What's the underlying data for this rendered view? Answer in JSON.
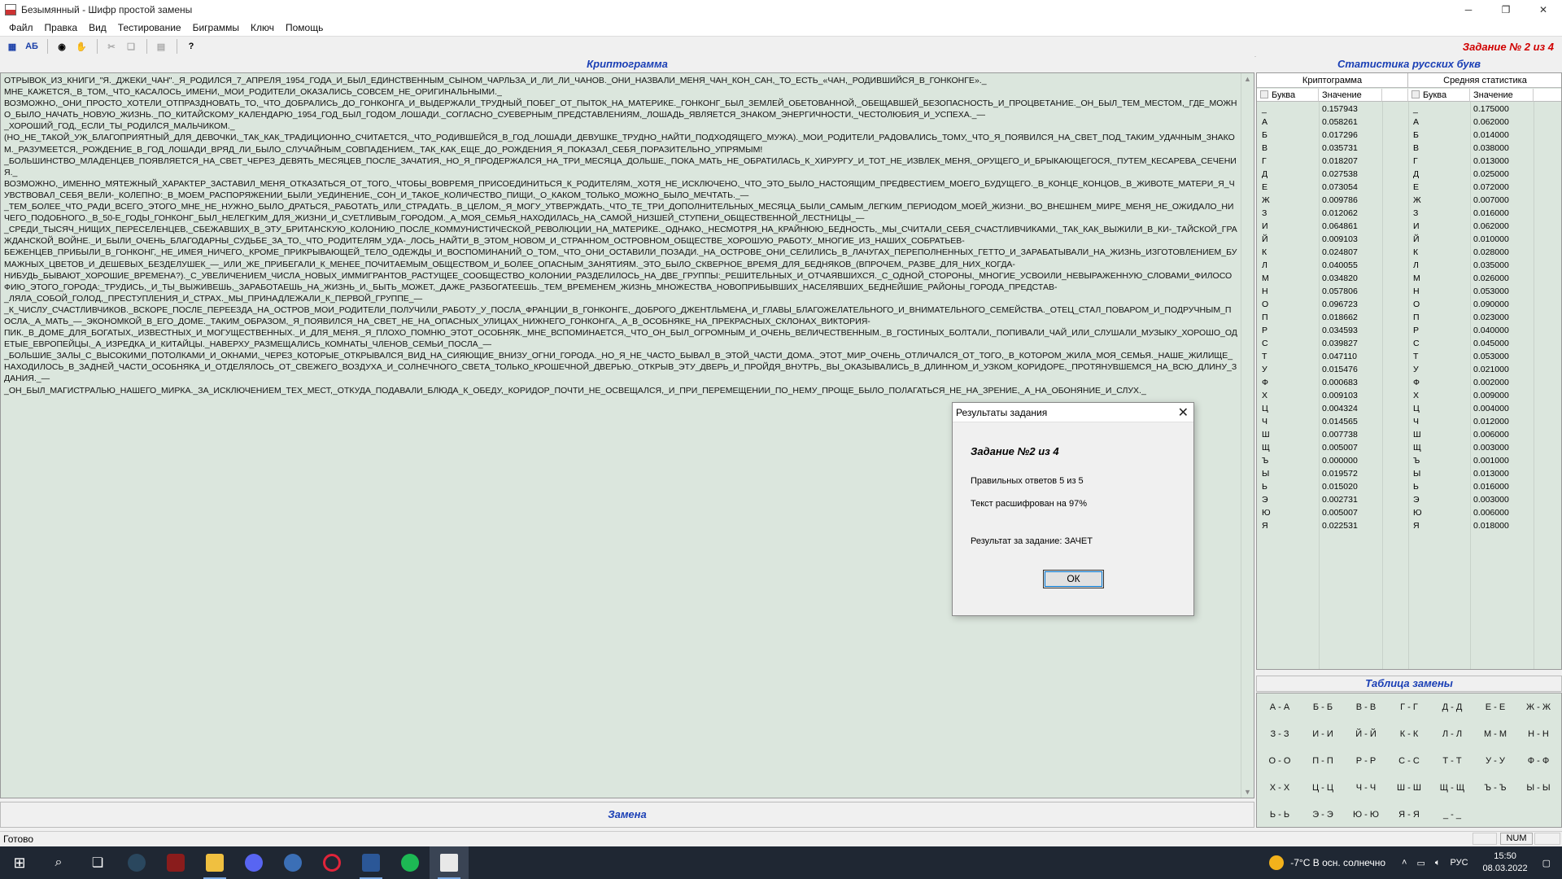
{
  "window": {
    "title": "Безымянный - Шифр простой замены"
  },
  "menu": [
    "Файл",
    "Правка",
    "Вид",
    "Тестирование",
    "Биграммы",
    "Ключ",
    "Помощь"
  ],
  "toolbar": {
    "btn_grid": "▦",
    "btn_ab": "АБ",
    "task_label": "Задание № 2 из 4"
  },
  "crypto": {
    "header": "Криптограмма",
    "text": "ОТРЫВОК_ИЗ_КНИГИ_\"Я._ДЖЕКИ_ЧАН\"._Я_РОДИЛСЯ_7_АПРЕЛЯ_1954_ГОДА_И_БЫЛ_ЕДИНСТВЕННЫМ_СЫНОМ_ЧАРЛЬЗА_И_ЛИ_ЛИ_ЧАНОВ._ОНИ_НАЗВАЛИ_МЕНЯ_ЧАН_КОН_САН,_ТО_ЕСТЬ_«ЧАН,_РОДИВШИЙСЯ_В_ГОНКОНГЕ»._\nМНЕ_КАЖЕТСЯ,_В_ТОМ,_ЧТО_КАСАЛОСЬ_ИМЕНИ,_МОИ_РОДИТЕЛИ_ОКАЗАЛИСЬ_СОВСЕМ_НЕ_ОРИГИНАЛЬНЫМИ._\nВОЗМОЖНО,_ОНИ_ПРОСТО_ХОТЕЛИ_ОТПРАЗДНОВАТЬ_ТО,_ЧТО_ДОБРАЛИСЬ_ДО_ГОНКОНГА_И_ВЫДЕРЖАЛИ_ТРУДНЫЙ_ПОБЕГ_ОТ_ПЫТОК_НА_МАТЕРИКЕ._ГОНКОНГ_БЫЛ_ЗЕМЛЕЙ_ОБЕТОВАННОЙ,_ОБЕЩАВШЕЙ_БЕЗОПАСНОСТЬ_И_ПРОЦВЕТАНИЕ._ОН_БЫЛ_ТЕМ_МЕСТОМ,_ГДЕ_МОЖНО_БЫЛО_НАЧАТЬ_НОВУЮ_ЖИЗНЬ._ПО_КИТАЙСКОМУ_КАЛЕНДАРЮ_1954_ГОД_БЫЛ_ГОДОМ_ЛОШАДИ._СОГЛАСНО_СУЕВЕРНЫМ_ПРЕДСТАВЛЕНИЯМ,_ЛОШАДЬ_ЯВЛЯЕТСЯ_ЗНАКОМ_ЭНЕРГИЧНОСТИ,_ЧЕСТОЛЮБИЯ_И_УСПЕХА._—\n_ХОРОШИЙ_ГОД,_ЕСЛИ_ТЫ_РОДИЛСЯ_МАЛЬЧИКОМ._\n(НО_НЕ_ТАКОЙ_УЖ_БЛАГОПРИЯТНЫЙ_ДЛЯ_ДЕВОЧКИ,_ТАК_КАК_ТРАДИЦИОННО_СЧИТАЕТСЯ,_ЧТО_РОДИВШЕЙСЯ_В_ГОД_ЛОШАДИ_ДЕВУШКЕ_ТРУДНО_НАЙТИ_ПОДХОДЯЩЕГО_МУЖА)._МОИ_РОДИТЕЛИ_РАДОВАЛИСЬ_ТОМУ,_ЧТО_Я_ПОЯВИЛСЯ_НА_СВЕТ_ПОД_ТАКИМ_УДАЧНЫМ_ЗНАКОМ._РАЗУМЕЕТСЯ,_РОЖДЕНИЕ_В_ГОД_ЛОШАДИ_ВРЯД_ЛИ_БЫЛО_СЛУЧАЙНЫМ_СОВПАДЕНИЕМ,_ТАК_КАК_ЕЩЕ_ДО_РОЖДЕНИЯ_Я_ПОКАЗАЛ_СЕБЯ_ПОРАЗИТЕЛЬНО_УПРЯМЫМ!\n_БОЛЬШИНСТВО_МЛАДЕНЦЕВ_ПОЯВЛЯЕТСЯ_НА_СВЕТ_ЧЕРЕЗ_ДЕВЯТЬ_МЕСЯЦЕВ_ПОСЛЕ_ЗАЧАТИЯ,_НО_Я_ПРОДЕРЖАЛСЯ_НА_ТРИ_МЕСЯЦА_ДОЛЬШЕ,_ПОКА_МАТЬ_НЕ_ОБРАТИЛАСЬ_К_ХИРУРГУ_И_ТОТ_НЕ_ИЗВЛЕК_МЕНЯ,_ОРУЩЕГО_И_БРЫКАЮЩЕГОСЯ,_ПУТЕМ_КЕСАРЕВА_СЕЧЕНИЯ._\nВОЗМОЖНО,_ИМЕННО_МЯТЕЖНЫЙ_ХАРАКТЕР_ЗАСТАВИЛ_МЕНЯ_ОТКАЗАТЬСЯ_ОТ_ТОГО,_ЧТОБЫ_ВОВРЕМЯ_ПРИСОЕДИНИТЬСЯ_К_РОДИТЕЛЯМ,_ХОТЯ_НЕ_ИСКЛЮЧЕНО,_ЧТО_ЭТО_БЫЛО_НАСТОЯЩИМ_ПРЕДВЕСТИЕМ_МОЕГО_БУДУЩЕГО._В_КОНЦЕ_КОНЦОВ,_В_ЖИВОТЕ_МАТЕРИ_Я_ЧУВСТВОВАЛ_СЕБЯ_ВЕЛИ-_КОЛЕПНО:_В_МОЕМ_РАСПОРЯЖЕНИИ_БЫЛИ_УЕДИНЕНИЕ,_СОН_И_ТАКОЕ_КОЛИЧЕСТВО_ПИЩИ,_О_КАКОМ_ТОЛЬКО_МОЖНО_БЫЛО_МЕЧТАТЬ._—\n_ТЕМ_БОЛЕЕ_ЧТО_РАДИ_ВСЕГО_ЭТОГО_МНЕ_НЕ_НУЖНО_БЫЛО_ДРАТЬСЯ,_РАБОТАТЬ_ИЛИ_СТРАДАТЬ._В_ЦЕЛОМ,_Я_МОГУ_УТВЕРЖДАТЬ,_ЧТО_ТЕ_ТРИ_ДОПОЛНИТЕЛЬНЫХ_МЕСЯЦА_БЫЛИ_САМЫМ_ЛЕГКИМ_ПЕРИОДОМ_МОЕЙ_ЖИЗНИ._ВО_ВНЕШНЕМ_МИРЕ_МЕНЯ_НЕ_ОЖИДАЛО_НИЧЕГО_ПОДОБНОГО._В_50-Е_ГОДЫ_ГОНКОНГ_БЫЛ_НЕЛЕГКИМ_ДЛЯ_ЖИЗНИ_И_СУЕТЛИВЫМ_ГОРОДОМ._А_МОЯ_СЕМЬЯ_НАХОДИЛАСЬ_НА_САМОЙ_НИЗШЕЙ_СТУПЕНИ_ОБЩЕСТВЕННОЙ_ЛЕСТНИЦЫ_—\n_СРЕДИ_ТЫСЯЧ_НИЩИХ_ПЕРЕСЕЛЕНЦЕВ,_СБЕЖАВШИХ_В_ЭТУ_БРИТАНСКУЮ_КОЛОНИЮ_ПОСЛЕ_КОММУНИСТИЧЕСКОЙ_РЕВОЛЮЦИИ_НА_МАТЕРИКЕ._ОДНАКО,_НЕСМОТРЯ_НА_КРАЙНЮЮ_БЕДНОСТЬ,_МЫ_СЧИТАЛИ_СЕБЯ_СЧАСТЛИВЧИКАМИ,_ТАК_КАК_ВЫЖИЛИ_В_КИ-_ТАЙСКОЙ_ГРАЖДАНСКОЙ_ВОЙНЕ._И_БЫЛИ_ОЧЕНЬ_БЛАГОДАРНЫ_СУДЬБЕ_ЗА_ТО,_ЧТО_РОДИТЕЛЯМ_УДА-_ЛОСЬ_НАЙТИ_В_ЭТОМ_НОВОМ_И_СТРАННОМ_ОСТРОВНОМ_ОБЩЕСТВЕ_ХОРОШУЮ_РАБОТУ._МНОГИЕ_ИЗ_НАШИХ_СОБРАТЬЕВ-\nБЕЖЕНЦЕВ_ПРИБЫЛИ_В_ГОНКОНГ,_НЕ_ИМЕЯ_НИЧЕГО,_КРОМЕ_ПРИКРЫВАЮЩЕЙ_ТЕЛО_ОДЕЖДЫ_И_ВОСПОМИНАНИЙ_О_ТОМ,_ЧТО_ОНИ_ОСТАВИЛИ_ПОЗАДИ._НА_ОСТРОВЕ_ОНИ_СЕЛИЛИСЬ_В_ЛАЧУГАХ_ПЕРЕПОЛНЕННЫХ_ГЕТТО_И_ЗАРАБАТЫВАЛИ_НА_ЖИЗНЬ_ИЗГОТОВЛЕНИЕМ_БУМАЖНЫХ_ЦВЕТОВ_И_ДЕШЕВЫХ_БЕЗДЕЛУШЕК_—_ИЛИ_ЖЕ_ПРИБЕГАЛИ_К_МЕНЕЕ_ПОЧИТАЕМЫМ_ОБЩЕСТВОМ_И_БОЛЕЕ_ОПАСНЫМ_ЗАНЯТИЯМ._ЭТО_БЫЛО_СКВЕРНОЕ_ВРЕМЯ_ДЛЯ_БЕДНЯКОВ_(ВПРОЧЕМ,_РАЗВЕ_ДЛЯ_НИХ_КОГДА-\nНИБУДЬ_БЫВАЮТ_ХОРОШИЕ_ВРЕМЕНА?)._С_УВЕЛИЧЕНИЕМ_ЧИСЛА_НОВЫХ_ИММИГРАНТОВ_РАСТУЩЕЕ_СООБЩЕСТВО_КОЛОНИИ_РАЗДЕЛИЛОСЬ_НА_ДВЕ_ГРУППЫ:_РЕШИТЕЛЬНЫХ_И_ОТЧАЯВШИХСЯ._С_ОДНОЙ_СТОРОНЫ,_МНОГИЕ_УСВОИЛИ_НЕВЫРАЖЕННУЮ_СЛОВАМИ_ФИЛОСОФИЮ_ЭТОГО_ГОРОДА:_ТРУДИСЬ,_И_ТЫ_ВЫЖИВЕШЬ,_ЗАРАБОТАЕШЬ_НА_ЖИЗНЬ_И,_БЫТЬ_МОЖЕТ,_ДАЖЕ_РАЗБОГАТЕЕШЬ._ТЕМ_ВРЕМЕНЕМ_ЖИЗНЬ_МНОЖЕСТВА_НОВОПРИБЫВШИХ_НАСЕЛЯВШИХ_БЕДНЕЙШИЕ_РАЙОНЫ_ГОРОДА_ПРЕДСТАВ-\n_ЛЯЛА_СОБОЙ_ГОЛОД,_ПРЕСТУПЛЕНИЯ_И_СТРАХ._МЫ_ПРИНАДЛЕЖАЛИ_К_ПЕРВОЙ_ГРУППЕ_—\n_К_ЧИСЛУ_СЧАСТЛИВЧИКОВ._ВСКОРЕ_ПОСЛЕ_ПЕРЕЕЗДА_НА_ОСТРОВ_МОИ_РОДИТЕЛИ_ПОЛУЧИЛИ_РАБОТУ_У_ПОСЛА_ФРАНЦИИ_В_ГОНКОНГЕ,_ДОБРОГО_ДЖЕНТЛЬМЕНА_И_ГЛАВЫ_БЛАГОЖЕЛАТЕЛЬНОГО_И_ВНИМАТЕЛЬНОГО_СЕМЕЙСТВА._ОТЕЦ_СТАЛ_ПОВАРОМ_И_ПОДРУЧНЫМ_ПОСЛА,_А_МАТЬ_—_ЭКОНОМКОЙ_В_ЕГО_ДОМЕ._ТАКИМ_ОБРАЗОМ,_Я_ПОЯВИЛСЯ_НА_СВЕТ_НЕ_НА_ОПАСНЫХ_УЛИЦАХ_НИЖНЕГО_ГОНКОНГА,_А_В_ОСОБНЯКЕ_НА_ПРЕКРАСНЫХ_СКЛОНАХ_ВИКТОРИЯ-\nПИК._В_ДОМЕ_ДЛЯ_БОГАТЫХ,_ИЗВЕСТНЫХ_И_МОГУЩЕСТВЕННЫХ._И_ДЛЯ_МЕНЯ._Я_ПЛОХО_ПОМНЮ_ЭТОТ_ОСОБНЯК._МНЕ_ВСПОМИНАЕТСЯ,_ЧТО_ОН_БЫЛ_ОГРОМНЫМ_И_ОЧЕНЬ_ВЕЛИЧЕСТВЕННЫМ._В_ГОСТИНЫХ_БОЛТАЛИ,_ПОПИВАЛИ_ЧАЙ_ИЛИ_СЛУШАЛИ_МУЗЫКУ_ХОРОШО_ОДЕТЫЕ_ЕВРОПЕЙЦЫ,_А_ИЗРЕДКА_И_КИТАЙЦЫ._НАВЕРХУ_РАЗМЕЩАЛИСЬ_КОМНАТЫ_ЧЛЕНОВ_СЕМЬИ_ПОСЛА_—\n_БОЛЬШИЕ_ЗАЛЫ_С_ВЫСОКИМИ_ПОТОЛКАМИ_И_ОКНАМИ,_ЧЕРЕЗ_КОТОРЫЕ_ОТКРЫВАЛСЯ_ВИД_НА_СИЯЮЩИЕ_ВНИЗУ_ОГНИ_ГОРОДА._НО_Я_НЕ_ЧАСТО_БЫВАЛ_В_ЭТОЙ_ЧАСТИ_ДОМА._ЭТОТ_МИР_ОЧЕНЬ_ОТЛИЧАЛСЯ_ОТ_ТОГО,_В_КОТОРОМ_ЖИЛА_МОЯ_СЕМЬЯ._НАШЕ_ЖИЛИЩЕ_НАХОДИЛОСЬ_В_ЗАДНЕЙ_ЧАСТИ_ОСОБНЯКА_И_ОТДЕЛЯЛОСЬ_ОТ_СВЕЖЕГО_ВОЗДУХА_И_СОЛНЕЧНОГО_СВЕТА_ТОЛЬКО_КРОШЕЧНОЙ_ДВЕРЬЮ._ОТКРЫВ_ЭТУ_ДВЕРЬ_И_ПРОЙДЯ_ВНУТРЬ,_ВЫ_ОКАЗЫВАЛИСЬ_В_ДЛИННОМ_И_УЗКОМ_КОРИДОРЕ,_ПРОТЯНУВШЕМСЯ_НА_ВСЮ_ДЛИНУ_ЗДАНИЯ._—\n_ОН_БЫЛ_МАГИСТРАЛЬЮ_НАШЕГО_МИРКА._ЗА_ИСКЛЮЧЕНИЕМ_ТЕХ_МЕСТ,_ОТКУДА_ПОДАВАЛИ_БЛЮДА_К_ОБЕДУ,_КОРИДОР_ПОЧТИ_НЕ_ОСВЕЩАЛСЯ,_И_ПРИ_ПЕРЕМЕЩЕНИИ_ПО_НЕМУ_ПРОЩЕ_БЫЛО_ПОЛАГАТЬСЯ_НЕ_НА_ЗРЕНИЕ,_А_НА_ОБОНЯНИЕ_И_СЛУХ._"
  },
  "zamena": {
    "label": "Замена"
  },
  "stats": {
    "header": "Статистика русских букв",
    "group_crypto": "Криптограмма",
    "group_avg": "Средняя статистика",
    "col_letter": "Буква",
    "col_value": "Значение",
    "crypto_rows": [
      [
        "_",
        "0.157943"
      ],
      [
        "А",
        "0.058261"
      ],
      [
        "Б",
        "0.017296"
      ],
      [
        "В",
        "0.035731"
      ],
      [
        "Г",
        "0.018207"
      ],
      [
        "Д",
        "0.027538"
      ],
      [
        "Е",
        "0.073054"
      ],
      [
        "Ж",
        "0.009786"
      ],
      [
        "З",
        "0.012062"
      ],
      [
        "И",
        "0.064861"
      ],
      [
        "Й",
        "0.009103"
      ],
      [
        "К",
        "0.024807"
      ],
      [
        "Л",
        "0.040055"
      ],
      [
        "М",
        "0.034820"
      ],
      [
        "Н",
        "0.057806"
      ],
      [
        "О",
        "0.096723"
      ],
      [
        "П",
        "0.018662"
      ],
      [
        "Р",
        "0.034593"
      ],
      [
        "С",
        "0.039827"
      ],
      [
        "Т",
        "0.047110"
      ],
      [
        "У",
        "0.015476"
      ],
      [
        "Ф",
        "0.000683"
      ],
      [
        "Х",
        "0.009103"
      ],
      [
        "Ц",
        "0.004324"
      ],
      [
        "Ч",
        "0.014565"
      ],
      [
        "Ш",
        "0.007738"
      ],
      [
        "Щ",
        "0.005007"
      ],
      [
        "Ъ",
        "0.000000"
      ],
      [
        "Ы",
        "0.019572"
      ],
      [
        "Ь",
        "0.015020"
      ],
      [
        "Э",
        "0.002731"
      ],
      [
        "Ю",
        "0.005007"
      ],
      [
        "Я",
        "0.022531"
      ]
    ],
    "avg_rows": [
      [
        "_",
        "0.175000"
      ],
      [
        "А",
        "0.062000"
      ],
      [
        "Б",
        "0.014000"
      ],
      [
        "В",
        "0.038000"
      ],
      [
        "Г",
        "0.013000"
      ],
      [
        "Д",
        "0.025000"
      ],
      [
        "Е",
        "0.072000"
      ],
      [
        "Ж",
        "0.007000"
      ],
      [
        "З",
        "0.016000"
      ],
      [
        "И",
        "0.062000"
      ],
      [
        "Й",
        "0.010000"
      ],
      [
        "К",
        "0.028000"
      ],
      [
        "Л",
        "0.035000"
      ],
      [
        "М",
        "0.026000"
      ],
      [
        "Н",
        "0.053000"
      ],
      [
        "О",
        "0.090000"
      ],
      [
        "П",
        "0.023000"
      ],
      [
        "Р",
        "0.040000"
      ],
      [
        "С",
        "0.045000"
      ],
      [
        "Т",
        "0.053000"
      ],
      [
        "У",
        "0.021000"
      ],
      [
        "Ф",
        "0.002000"
      ],
      [
        "Х",
        "0.009000"
      ],
      [
        "Ц",
        "0.004000"
      ],
      [
        "Ч",
        "0.012000"
      ],
      [
        "Ш",
        "0.006000"
      ],
      [
        "Щ",
        "0.003000"
      ],
      [
        "Ъ",
        "0.001000"
      ],
      [
        "Ы",
        "0.013000"
      ],
      [
        "Ь",
        "0.016000"
      ],
      [
        "Э",
        "0.003000"
      ],
      [
        "Ю",
        "0.006000"
      ],
      [
        "Я",
        "0.018000"
      ]
    ]
  },
  "replacement": {
    "header": "Таблица замены",
    "pairs": [
      "А - А",
      "Б - Б",
      "В - В",
      "Г - Г",
      "Д - Д",
      "Е - Е",
      "Ж - Ж",
      "З - З",
      "И - И",
      "Й - Й",
      "К - К",
      "Л - Л",
      "М - М",
      "Н - Н",
      "О - О",
      "П - П",
      "Р - Р",
      "С - С",
      "Т - Т",
      "У - У",
      "Ф - Ф",
      "Х - Х",
      "Ц - Ц",
      "Ч - Ч",
      "Ш - Ш",
      "Щ - Щ",
      "Ъ - Ъ",
      "Ы - Ы",
      "Ь - Ь",
      "Э - Э",
      "Ю - Ю",
      "Я - Я",
      "_ - _"
    ]
  },
  "statusbar": {
    "text": "Готово",
    "num": "NUM"
  },
  "dialog": {
    "title": "Результаты задания",
    "heading": "Задание №2 из 4",
    "correct": "Правильных ответов 5 из 5",
    "decrypted": "Текст расшифрован на 97%",
    "result": "Результат за задание: ЗАЧЕТ",
    "ok": "ОК"
  },
  "taskbar": {
    "weather": "-7°C  В осн. солнечно",
    "lang": "РУС",
    "time": "15:50",
    "date": "08.03.2022"
  },
  "colors": {
    "accent": "#1a3fb5",
    "task_red": "#d00000",
    "panel_bg": "#dbe6dd"
  }
}
